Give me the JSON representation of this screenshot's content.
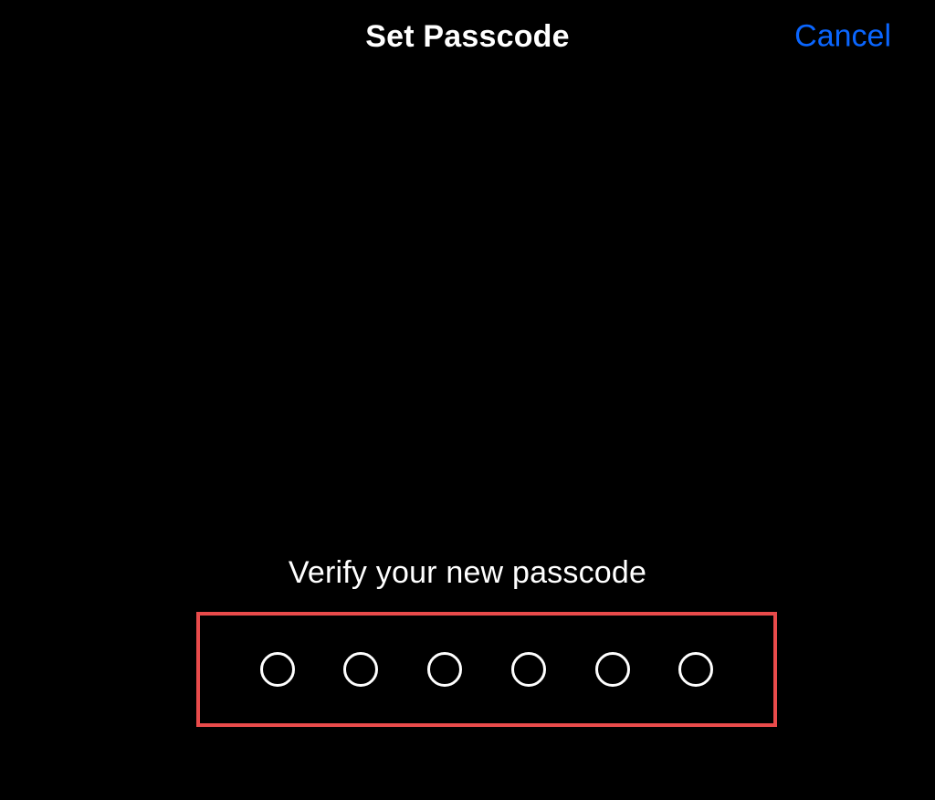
{
  "header": {
    "title": "Set Passcode",
    "cancel_label": "Cancel"
  },
  "prompt": {
    "text": "Verify your new passcode"
  },
  "passcode": {
    "digits": 6,
    "filled": 0,
    "highlight_color": "#e94b4b"
  },
  "colors": {
    "background": "#000000",
    "text": "#ffffff",
    "accent": "#0a66ff"
  }
}
